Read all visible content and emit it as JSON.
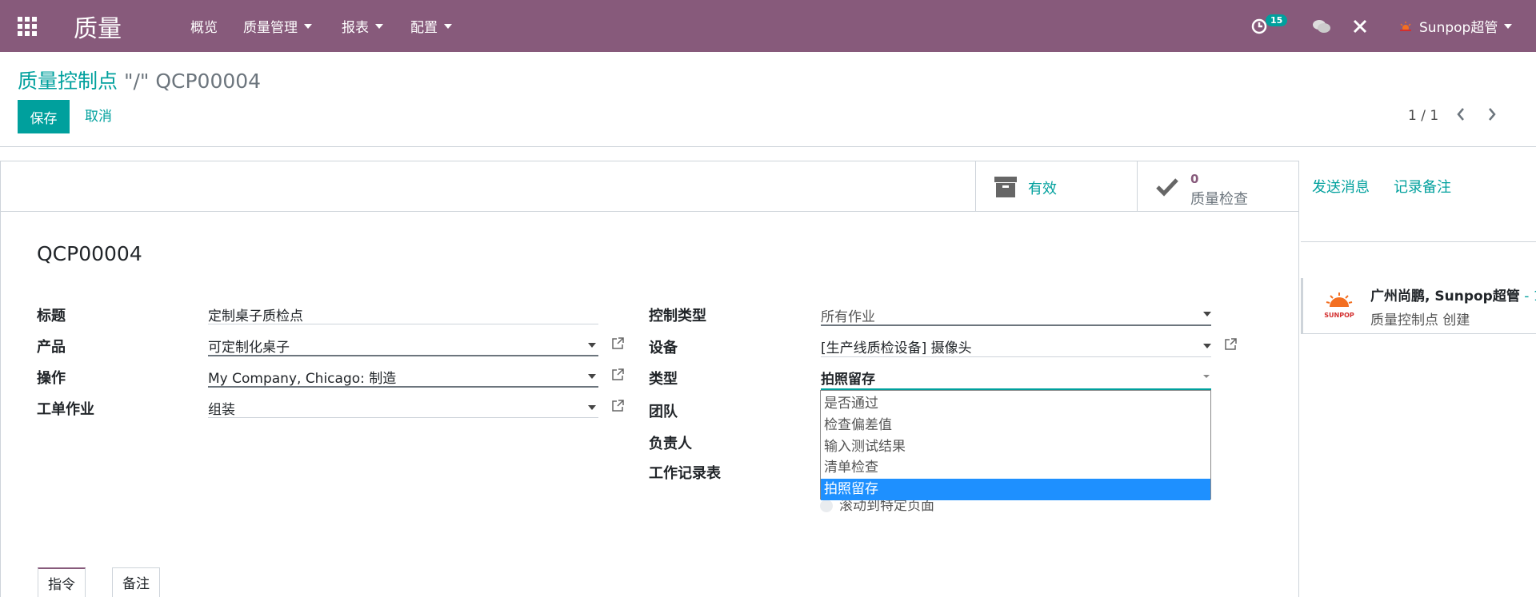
{
  "navbar": {
    "brand": "质量",
    "menus": [
      "概览",
      "质量管理",
      "报表",
      "配置"
    ],
    "activity_count": "15",
    "user_name": "Sunpop超管"
  },
  "control_panel": {
    "breadcrumb_parent": "质量控制点",
    "breadcrumb_sep": " \"/\" ",
    "breadcrumb_current": "QCP00004",
    "save_label": "保存",
    "cancel_label": "取消",
    "pager": "1 / 1"
  },
  "stat_buttons": {
    "active_label": "有效",
    "checks_count": "0",
    "checks_label": "质量检查"
  },
  "form": {
    "record_name": "QCP00004",
    "left": {
      "title_label": "标题",
      "title_value": "定制桌子质检点",
      "product_label": "产品",
      "product_value": "可定制化桌子",
      "operation_label": "操作",
      "operation_value": "My Company, Chicago: 制造",
      "workorder_label": "工单作业",
      "workorder_value": "组装"
    },
    "right": {
      "control_type_label": "控制类型",
      "control_type_value": "所有作业",
      "equipment_label": "设备",
      "equipment_value": "[生产线质检设备] 摄像头",
      "type_label": "类型",
      "type_value": "拍照留存",
      "team_label": "团队",
      "responsible_label": "负责人",
      "worksheet_label": "工作记录表",
      "radio_label": "滚动到特定页面"
    },
    "type_options": [
      "是否通过",
      "检查偏差值",
      "输入测试结果",
      "清单检查",
      "拍照留存"
    ],
    "tabs": [
      "指令",
      "备注"
    ]
  },
  "chatter": {
    "send_message": "发送消息",
    "log_note": "记录备注",
    "message_author": "广州尚鹏, Sunpop超管",
    "message_time": " - 1",
    "message_body": "质量控制点 创建",
    "logo_text": "SUNPOP"
  },
  "colors": {
    "navbar": "#875A7B",
    "accent": "#00A09D",
    "selected_option": "#1E90FF"
  }
}
